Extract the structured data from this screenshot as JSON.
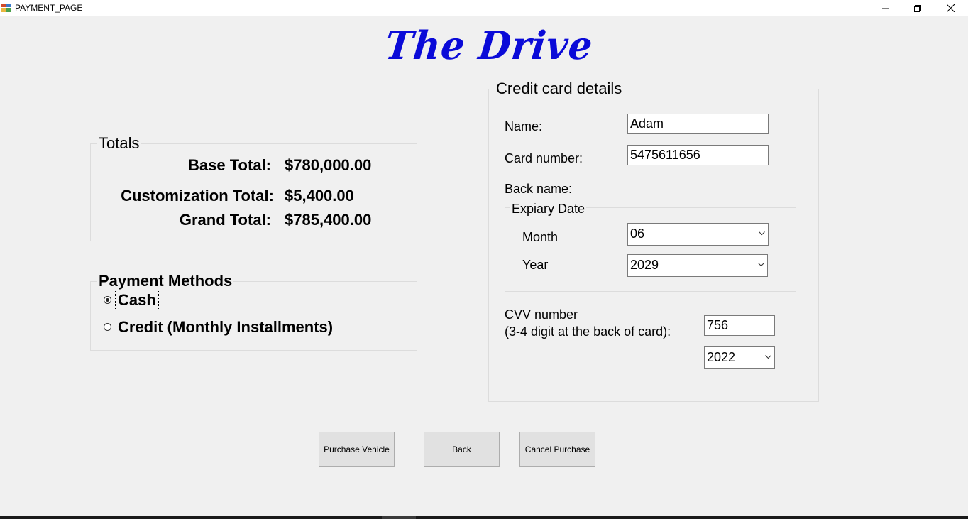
{
  "window": {
    "title": "PAYMENT_PAGE",
    "icons": [
      "app-icon",
      "minimize-icon",
      "restore-icon",
      "close-icon"
    ]
  },
  "brand": {
    "text": "The Drive",
    "color": "#0a0ad8"
  },
  "totals": {
    "group_label": "Totals",
    "base_label": "Base Total:",
    "base_value": "$780,000.00",
    "custom_label": "Customization Total:",
    "custom_value": "$5,400.00",
    "grand_label": "Grand Total:",
    "grand_value": "$785,400.00"
  },
  "payment_methods": {
    "group_label": "Payment Methods",
    "options": [
      {
        "label": "Cash",
        "selected": true
      },
      {
        "label": "Credit (Monthly Installments)",
        "selected": false
      }
    ]
  },
  "card": {
    "group_label": "Credit card details",
    "name_label": "Name:",
    "name_value": "Adam",
    "number_label": "Card number:",
    "number_value": "5475611656",
    "back_name_label": "Back name:",
    "expiry": {
      "group_label": "Expiary Date",
      "month_label": "Month",
      "month_value": "06",
      "year_label": "Year",
      "year_value": "2029"
    },
    "cvv_label": "CVV number",
    "cvv_hint": "(3-4 digit at the back of card):",
    "cvv_value": "756",
    "extra_year_value": "2022"
  },
  "buttons": {
    "purchase": "Purchase Vehicle",
    "back": "Back",
    "cancel": "Cancel Purchase"
  }
}
